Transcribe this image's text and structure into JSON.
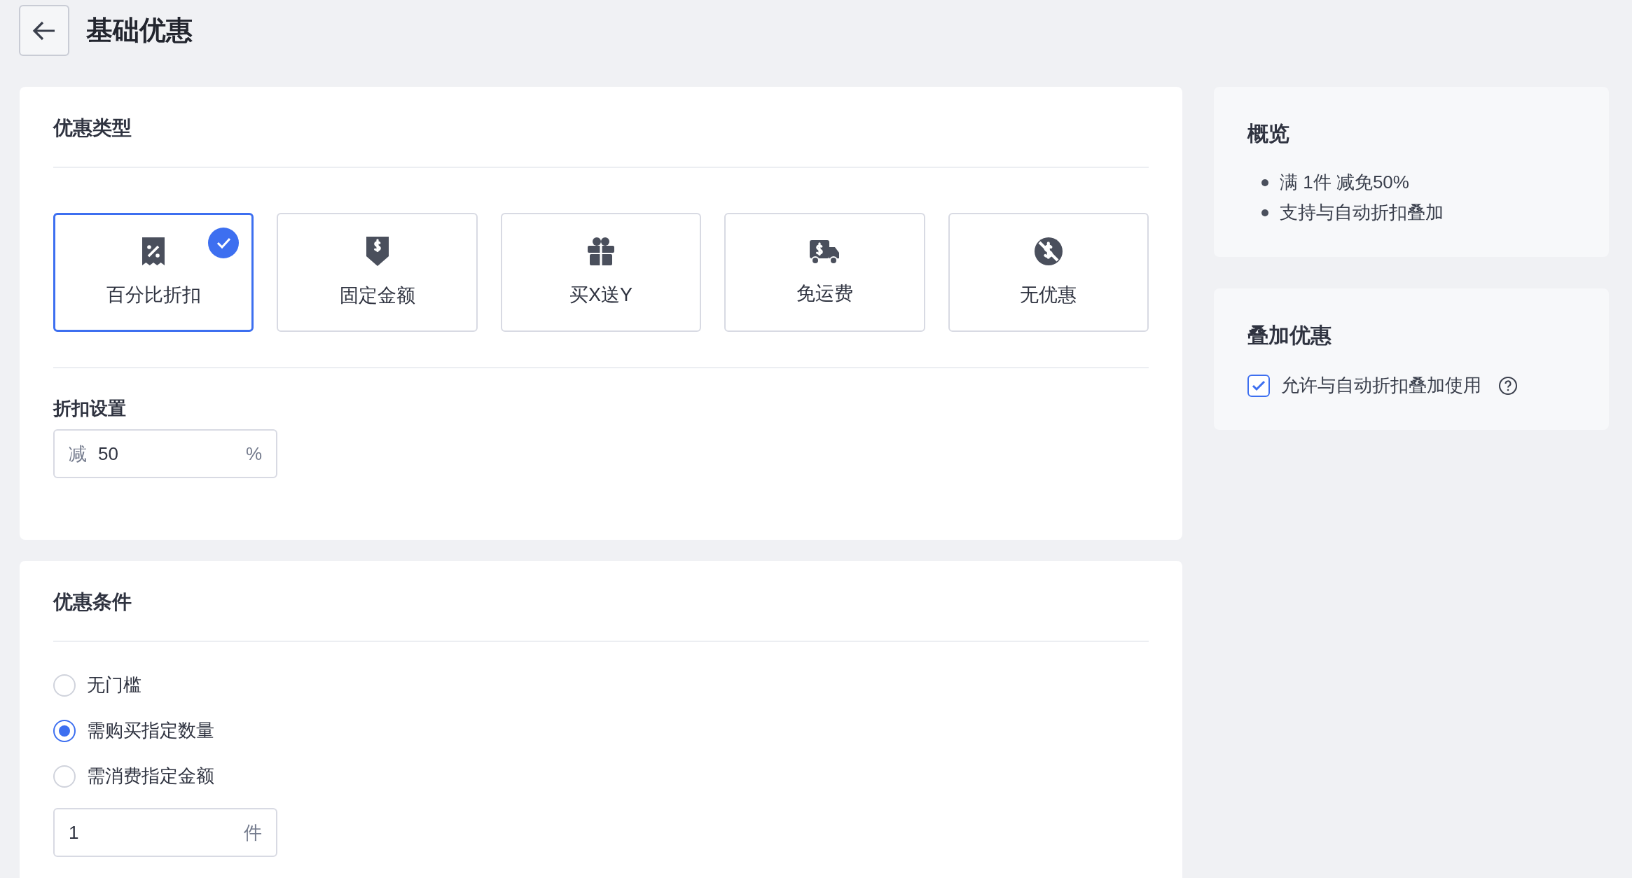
{
  "header": {
    "title": "基础优惠"
  },
  "discount_type": {
    "title": "优惠类型",
    "options": [
      {
        "kind": "percent",
        "label": "百分比折扣",
        "selected": true
      },
      {
        "kind": "fixed",
        "label": "固定金额",
        "selected": false
      },
      {
        "kind": "gift",
        "label": "买X送Y",
        "selected": false
      },
      {
        "kind": "shipping",
        "label": "免运费",
        "selected": false
      },
      {
        "kind": "none",
        "label": "无优惠",
        "selected": false
      }
    ]
  },
  "discount_settings": {
    "title": "折扣设置",
    "prefix": "减",
    "value": "50",
    "suffix": "%"
  },
  "conditions": {
    "title": "优惠条件",
    "options": [
      {
        "label": "无门槛",
        "selected": false
      },
      {
        "label": "需购买指定数量",
        "selected": true
      },
      {
        "label": "需消费指定金额",
        "selected": false
      }
    ],
    "quantity": {
      "value": "1",
      "suffix": "件"
    }
  },
  "overview": {
    "title": "概览",
    "items": [
      "满 1件 减免50%",
      "支持与自动折扣叠加"
    ]
  },
  "stacking": {
    "title": "叠加优惠",
    "checkbox": {
      "label": "允许与自动折扣叠加使用",
      "checked": true
    }
  }
}
